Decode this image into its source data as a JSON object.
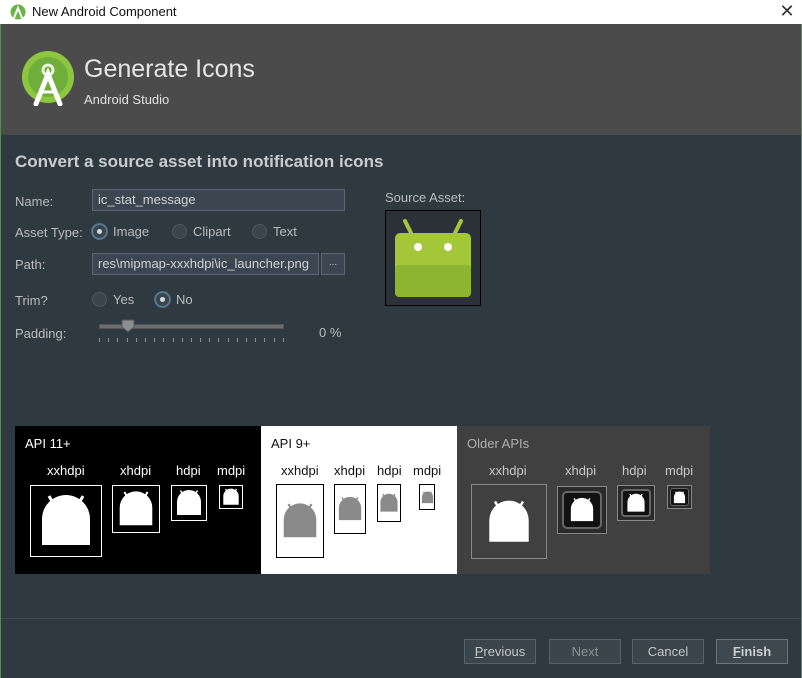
{
  "window": {
    "title": "New Android Component",
    "close_glyph": "✕"
  },
  "header": {
    "title": "Generate Icons",
    "subtitle": "Android Studio",
    "logo_icon": "android-studio-logo-icon"
  },
  "section_title": "Convert a source asset into notification icons",
  "form": {
    "name_label": "Name:",
    "name_value": "ic_stat_message",
    "asset_type_label": "Asset Type:",
    "asset_types": [
      "Image",
      "Clipart",
      "Text"
    ],
    "asset_type_selected": "Image",
    "path_label": "Path:",
    "path_value": "res\\mipmap-xxxhdpi\\ic_launcher.png",
    "browse_label": "...",
    "trim_label": "Trim?",
    "trim_options": [
      "Yes",
      "No"
    ],
    "trim_selected": "No",
    "padding_label": "Padding:",
    "padding_value": "0 %",
    "padding_percent": 0,
    "source_asset_label": "Source Asset:"
  },
  "previews": {
    "api11": {
      "title": "API 11+",
      "densities": [
        "xxhdpi",
        "xhdpi",
        "hdpi",
        "mdpi"
      ]
    },
    "api9": {
      "title": "API 9+",
      "densities": [
        "xxhdpi",
        "xhdpi",
        "hdpi",
        "mdpi"
      ]
    },
    "older": {
      "title": "Older APIs",
      "densities": [
        "xxhdpi",
        "xhdpi",
        "hdpi",
        "mdpi"
      ]
    }
  },
  "buttons": {
    "previous": {
      "label": "Previous",
      "mnemonic": "P",
      "rest": "revious"
    },
    "next": "Next",
    "cancel": "Cancel",
    "finish": {
      "label": "Finish",
      "mnemonic": "F",
      "rest": "inish"
    }
  },
  "colors": {
    "accent_green": "#a4c639",
    "panel_bg": "#2f3a40",
    "header_bg": "#4b4b4b"
  }
}
